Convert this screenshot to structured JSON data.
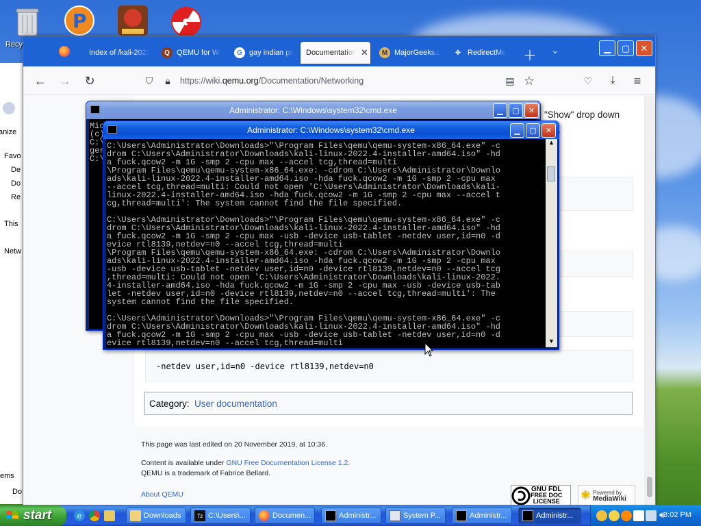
{
  "desktop": {
    "recycle_label": "Recy"
  },
  "explorer": {
    "items": [
      "anize",
      "Favo",
      "De",
      "Do",
      "Re",
      "This",
      "Netw",
      "ems",
      "Do"
    ]
  },
  "browser": {
    "tabs": [
      {
        "label": "Index of /kali-2022",
        "icon": "folder-icon"
      },
      {
        "label": "QEMU for Wi",
        "icon": "qemu-icon"
      },
      {
        "label": "gay indian po",
        "icon": "google-icon"
      },
      {
        "label": "Documentation",
        "icon": "qemu-docs-icon"
      },
      {
        "label": "MajorGeeks.c",
        "icon": "majorgeeks-icon"
      },
      {
        "label": "RedirectMe",
        "icon": "redirect-icon"
      }
    ],
    "url_prefix": "https://wiki.",
    "url_domain": "qemu.org",
    "url_path": "/Documentation/Networking"
  },
  "wiki": {
    "snippet_right": "\"Show\" drop down",
    "snippet_dot": ".",
    "code_line": "-netdev user,id=n0 -device rtl8139,netdev=n0",
    "category_label": "Category:",
    "category_link": "User documentation",
    "last_edited": "This page was last edited on 20 November 2019, at 10:36.",
    "license_prefix": "Content is available under ",
    "license_link": "GNU Free Documentation License 1.2",
    "license_suffix": ".",
    "trademark": "QEMU is a trademark of Fabrice Bellard.",
    "about_link": "About QEMU",
    "badge_gfdl": [
      "GNU FDL",
      "FREE DOC",
      "LICENSE"
    ],
    "badge_mw": [
      "Powered by",
      "MediaWiki"
    ]
  },
  "cmd_back": {
    "title": "Administrator: C:\\Windows\\system32\\cmd.exe",
    "lines": [
      "Mic",
      "(c)",
      "",
      "C:\\",
      "ger",
      "",
      "C:\\"
    ]
  },
  "cmd_front": {
    "title": "Administrator: C:\\Windows\\system32\\cmd.exe",
    "text": "C:\\Users\\Administrator\\Downloads>\"\\Program Files\\qemu\\qemu-system-x86_64.exe\" -c\ndrom C:\\Users\\Administrator\\Downloads\\kali-linux-2022.4-installer-amd64.iso\" -hd\na fuck.qcow2 -m 1G -smp 2 -cpu max --accel tcg,thread=multi\n\\Program Files\\qemu\\qemu-system-x86_64.exe: -cdrom C:\\Users\\Administrator\\Downlo\nads\\kali-linux-2022.4-installer-amd64.iso -hda fuck.qcow2 -m 1G -smp 2 -cpu max\n--accel tcg,thread=multi: Could not open 'C:\\Users\\Administrator\\Downloads\\kali-\nlinux-2022.4-installer-amd64.iso -hda fuck.qcow2 -m 1G -smp 2 -cpu max --accel t\ncg,thread=multi': The system cannot find the file specified.\n\nC:\\Users\\Administrator\\Downloads>\"\\Program Files\\qemu\\qemu-system-x86_64.exe\" -c\ndrom C:\\Users\\Administrator\\Downloads\\kali-linux-2022.4-installer-amd64.iso\" -hd\na fuck.qcow2 -m 1G -smp 2 -cpu max -usb -device usb-tablet -netdev user,id=n0 -d\nevice rtl8139,netdev=n0 --accel tcg,thread=multi\n\\Program Files\\qemu\\qemu-system-x86_64.exe: -cdrom C:\\Users\\Administrator\\Downlo\nads\\kali-linux-2022.4-installer-amd64.iso -hda fuck.qcow2 -m 1G -smp 2 -cpu max\n-usb -device usb-tablet -netdev user,id=n0 -device rtl8139,netdev=n0 --accel tcg\n,thread=multi: Could not open 'C:\\Users\\Administrator\\Downloads\\kali-linux-2022.\n4-installer-amd64.iso -hda fuck.qcow2 -m 1G -smp 2 -cpu max -usb -device usb-tab\nlet -netdev user,id=n0 -device rtl8139,netdev=n0 --accel tcg,thread=multi': The\nsystem cannot find the file specified.\n\nC:\\Users\\Administrator\\Downloads>\"\\Program Files\\qemu\\qemu-system-x86_64.exe\" -c\ndrom C:\\Users\\Administrator\\Downloads\\kali-linux-2022.4-installer-amd64.iso\" -hd\na fuck.qcow2 -m 1G -smp 2 -cpu max -usb -device usb-tablet -netdev user,id=n0 -d\nevice rtl8139,netdev=n0 --accel tcg,thread=multi"
  },
  "taskbar": {
    "start_label": "start",
    "tasks": [
      {
        "label": "Downloads",
        "icon": "folder-icon"
      },
      {
        "label": "C:\\Users\\...",
        "icon": "cmd-path-icon"
      },
      {
        "label": "Documen...",
        "icon": "firefox-icon"
      },
      {
        "label": "Administr...",
        "icon": "cmd-icon"
      },
      {
        "label": "System P...",
        "icon": "system-properties-icon"
      },
      {
        "label": "Administr...",
        "icon": "cmd-icon"
      },
      {
        "label": "Administr...",
        "icon": "cmd-icon"
      }
    ],
    "clock": "3:02 PM"
  }
}
